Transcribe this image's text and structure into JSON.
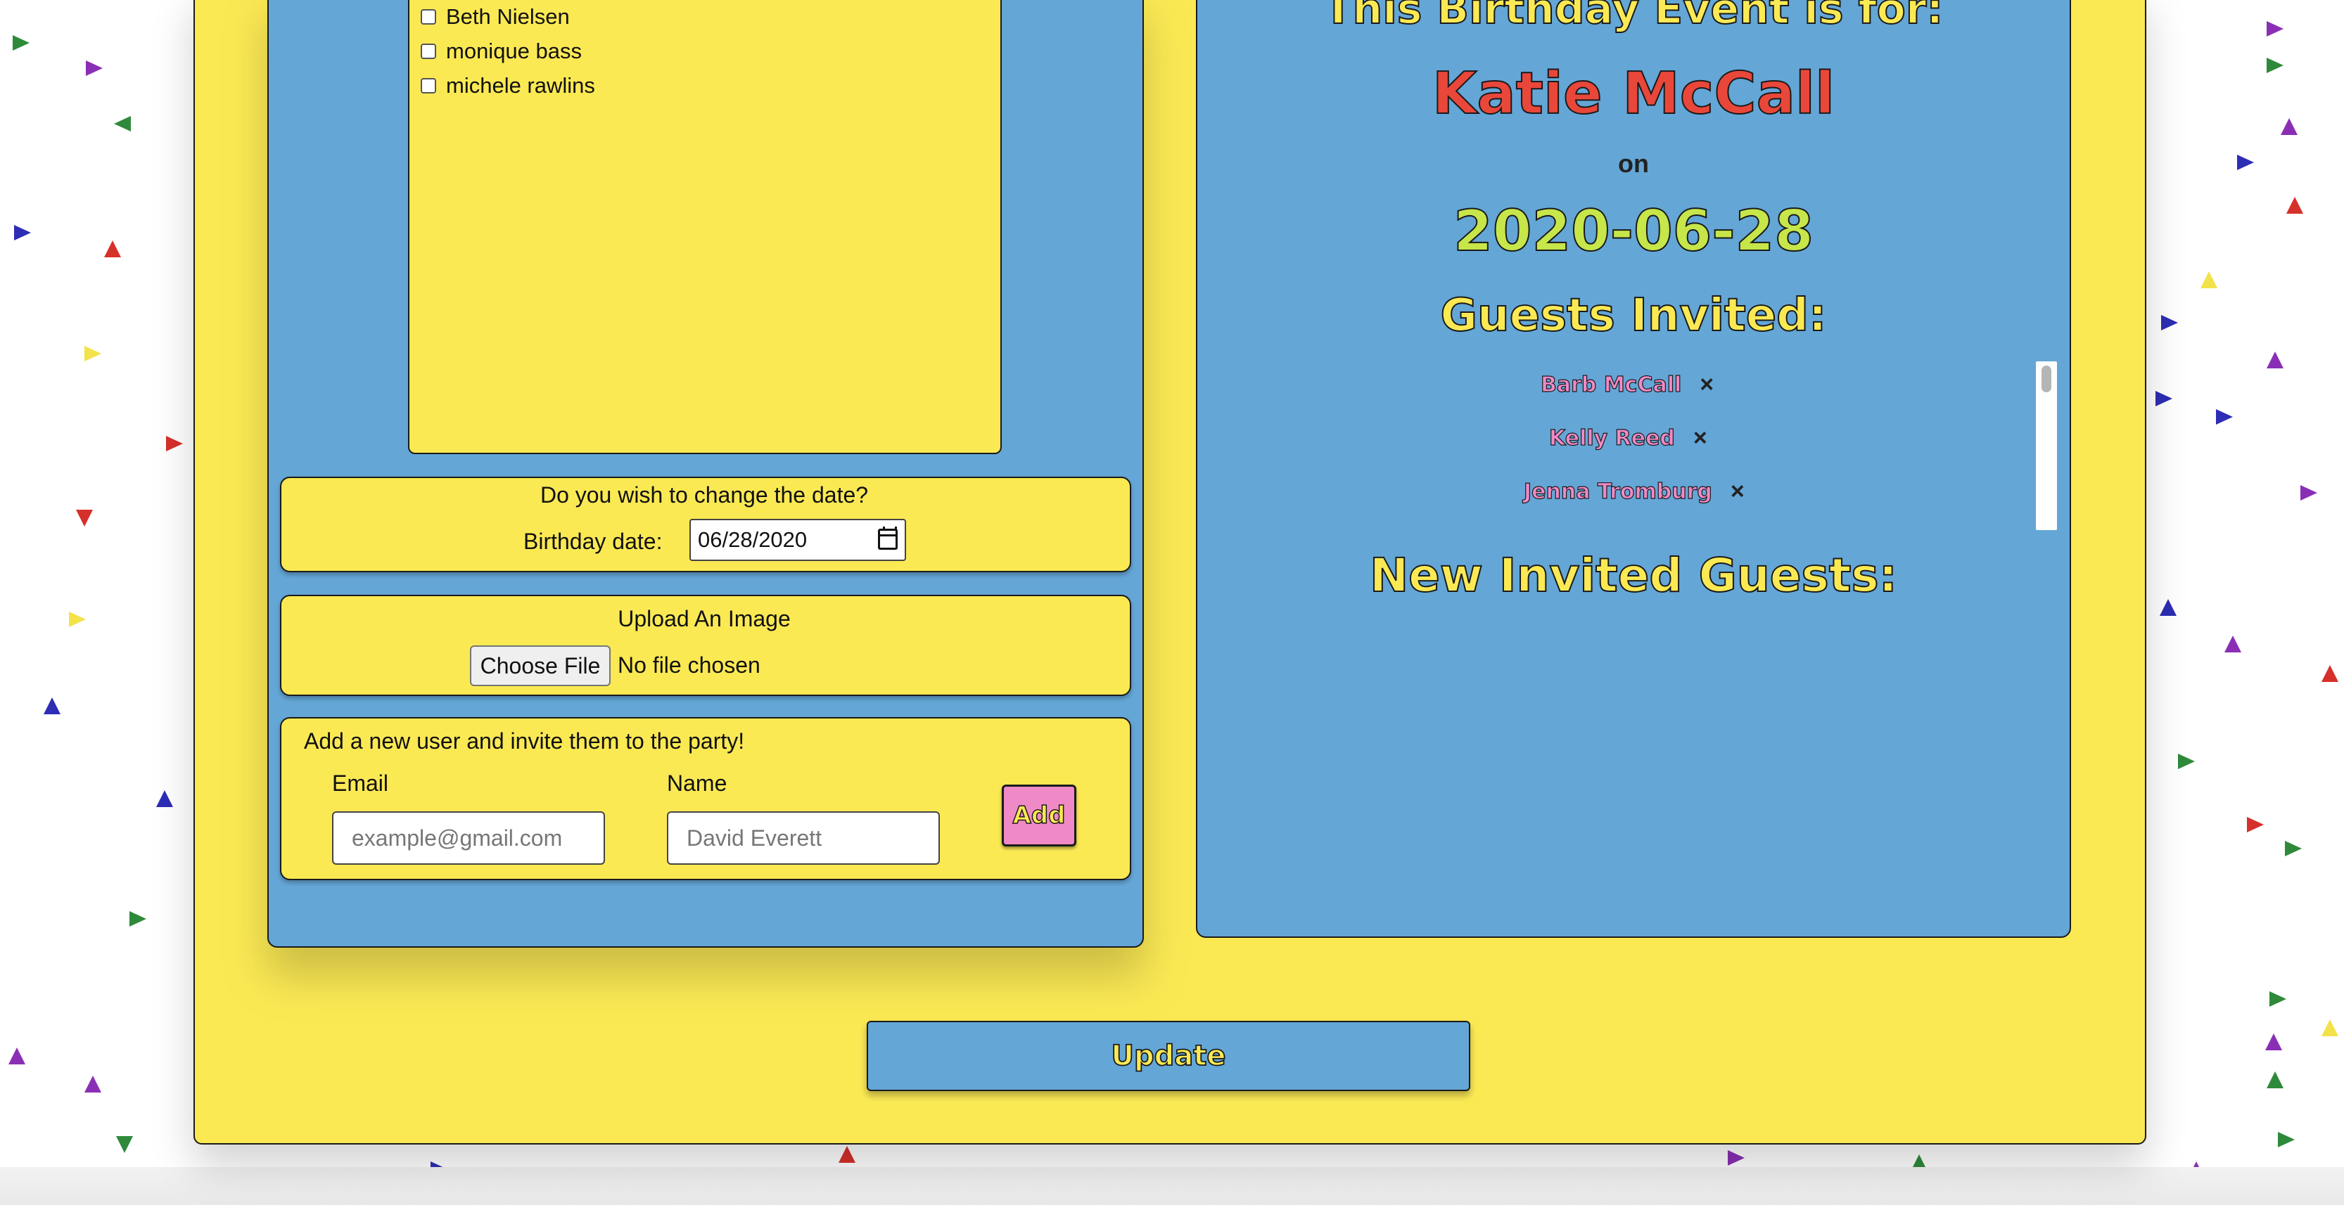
{
  "guest_list": {
    "options": [
      {
        "label": "Beth Nielsen",
        "checked": false
      },
      {
        "label": "monique bass",
        "checked": false
      },
      {
        "label": "michele rawlins",
        "checked": false
      }
    ]
  },
  "date_section": {
    "title": "Do you wish to change the date?",
    "label": "Birthday date:",
    "value": "06/28/2020"
  },
  "image_section": {
    "title": "Upload An Image",
    "button_label": "Choose File",
    "status": "No file chosen"
  },
  "new_user_section": {
    "title": "Add a new user and invite them to the party!",
    "email_label": "Email",
    "email_placeholder": "example@gmail.com",
    "name_label": "Name",
    "name_placeholder": "David Everett",
    "add_label": "Add"
  },
  "event": {
    "heading": "This Birthday Event is for:",
    "person": "Katie McCall",
    "on_label": "on",
    "date": "2020-06-28",
    "guests_heading": "Guests Invited:",
    "guests": [
      {
        "name": "Barb McCall",
        "remove": "×"
      },
      {
        "name": "Kelly Reed",
        "remove": "×"
      },
      {
        "name": "Jenna Tromburg",
        "remove": "×"
      }
    ],
    "new_guests_heading": "New Invited Guests:"
  },
  "update_label": "Update",
  "colors": {
    "yellow": "#fbe954",
    "blue": "#64a6d6",
    "pink": "#f08ac6",
    "red": "#e8473a",
    "lime": "#c6e64a"
  }
}
